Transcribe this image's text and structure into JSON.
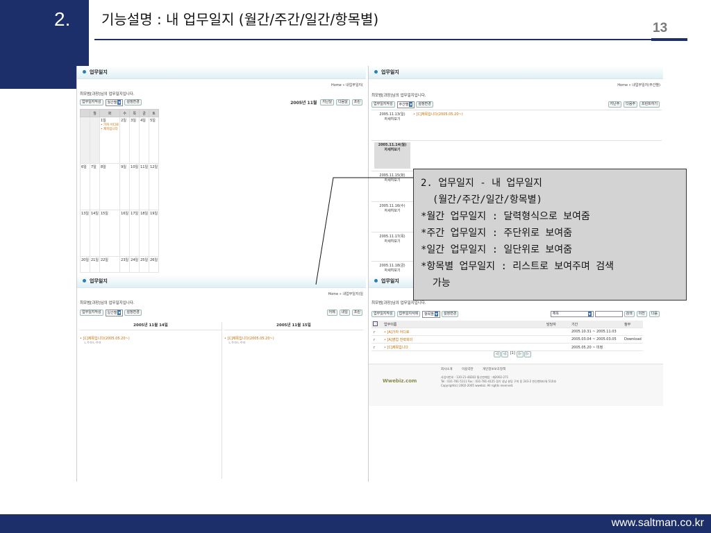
{
  "slide": {
    "section_number": "2.",
    "title": "기능설명 : 내 업무일지 (월간/주간/일간/항목별)",
    "page_number": "13",
    "footer_url": "www.saltman.co.kr"
  },
  "panels": {
    "monthly": {
      "header": "업무일지",
      "breadcrumb": "Home » 내업무일지(",
      "greeting": "최모범[과장]님의 업무일지입니다.",
      "buttons": [
        "업무일지작성",
        "설정변경"
      ],
      "view_select": "월간별",
      "period": "2005년 11월",
      "nav_buttons": [
        "지난달",
        "다음달",
        "프린"
      ],
      "weekdays": [
        "월",
        "화",
        "수",
        "목",
        "금",
        "토"
      ],
      "weeks": [
        [
          "",
          "",
          "1일",
          "2일",
          "3일",
          "4일",
          "5일"
        ],
        [
          "6일",
          "7일",
          "8일",
          "9일",
          "10일",
          "11일",
          "12일"
        ],
        [
          "13일",
          "14일",
          "15일",
          "16일",
          "17일",
          "18일",
          "19일"
        ],
        [
          "20일",
          "21일",
          "22일",
          "23일",
          "24일",
          "25일",
          "26일"
        ]
      ],
      "events": [
        "가자 어디로",
        "제목입니다"
      ]
    },
    "weekly": {
      "header": "업무일지",
      "breadcrumb": "Home » 내업무일지(주간별)",
      "greeting": "최모범[과장]님의 업무일지입니다.",
      "buttons": [
        "업무일지작성",
        "설정변경"
      ],
      "view_select": "주간별",
      "nav_buttons": [
        "지난주",
        "다음주",
        "프린트하기"
      ],
      "days": [
        {
          "date": "2005.11.13(일)",
          "link": "자세히보기",
          "entry": "[C]제목입니다(2005.05.20~)"
        },
        {
          "date": "2005.11.14(월)",
          "link": "자세히보기",
          "entry": ""
        },
        {
          "date": "2005.11.15(화)",
          "link": "자세히보기",
          "entry": ""
        },
        {
          "date": "2005.11.16(수)",
          "link": "자세히보기",
          "entry": ""
        },
        {
          "date": "2005.11.17(목)",
          "link": "자세히보기",
          "entry": ""
        },
        {
          "date": "2005.11.18(금)",
          "link": "자세히보기",
          "entry": ""
        }
      ]
    },
    "daily": {
      "header": "업무일지",
      "breadcrumb": "Home » 내업무일지(일",
      "greeting": "최모범[과장]님의 업무일지입니다.",
      "buttons": [
        "업무일지작성",
        "설정변경"
      ],
      "view_select": "일간별",
      "nav_buttons": [
        "어제",
        "내일",
        "프린"
      ],
      "columns": [
        {
          "date": "2005년 11월 14일",
          "entry": "[C]제목입니다(2005.05.20~)",
          "sub": "ㄴㅇㅁㄴㅇㅁ"
        },
        {
          "date": "2005년 11월 15일",
          "entry": "[C]제목입니다(2005.05.20~)",
          "sub": "ㄴㅇㅁㄴㅇㅁ"
        }
      ]
    },
    "items": {
      "header": "업무일지",
      "greeting": "최모범[과장]님의 업무일지입니다.",
      "buttons": [
        "업무일지작성",
        "업무일지삭제",
        "설정변경"
      ],
      "view_select": "항목별",
      "search_field": "제목",
      "search_buttons": [
        "검색",
        "이전",
        "다음"
      ],
      "table_headers": [
        "업무이름",
        "담당자",
        "기간",
        "첨부"
      ],
      "rows": [
        {
          "name": "[A]가자 어디로",
          "period": "2005.10.31 ~ 2005.11.03",
          "file": ""
        },
        {
          "name": "[A]영업 전략회의",
          "period": "2005.03.04 ~ 2005.03.05",
          "file": "Download"
        },
        {
          "name": "[C]제목입니다",
          "period": "2005.05.20 ~ 미정",
          "file": ""
        }
      ],
      "pager": "[1]",
      "footer_links": [
        "회사소개",
        "이용약관",
        "개인정보보호정책"
      ],
      "footer_logo": "Wwebiz.com",
      "footer_text": [
        "사업자번호 : 120-21-48302 통신판매업 : 제2002-271",
        "Tel : 031-781-5111 Fax : 031-781-4125 경기 성남 분당 구미 동 243-2 한신벤처타워 510호",
        "Copyright(c) 2002-2005 wwebiz. All rights reserved."
      ]
    }
  },
  "callout": {
    "lines": [
      "2. 업무일지 - 내 업무일지",
      "  (월간/주간/일간/항목별)",
      "*월간 업무일지 : 달력형식으로 보여줌",
      "*주간 업무일지 : 주단위로 보여줌",
      "*일간 업무일지 : 일단위로 보여줌",
      "*항목별 업무일지 : 리스트로 보여주며 검색",
      "  가능"
    ]
  },
  "colors": {
    "navy": "#1d2f6b",
    "callout_bg": "#d3d3d3",
    "header_gradient": "#dff0f6"
  }
}
